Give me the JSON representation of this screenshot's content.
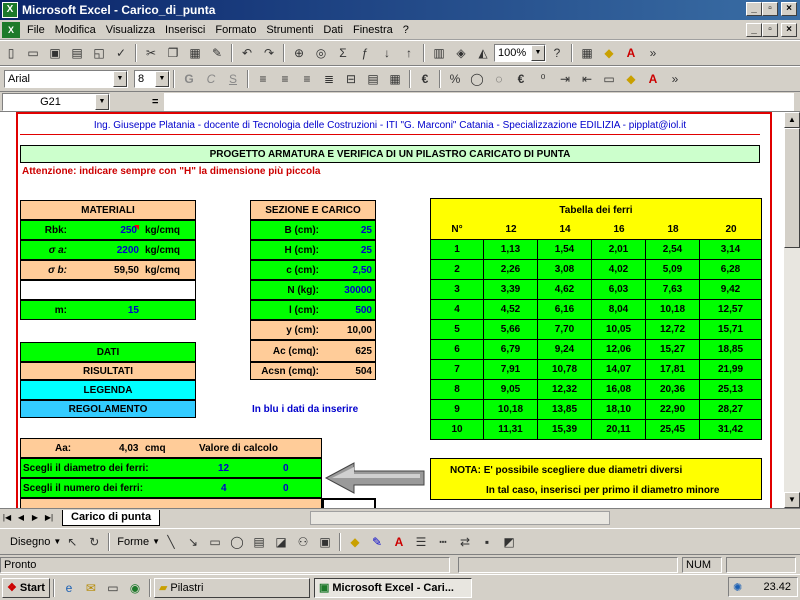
{
  "window": {
    "title": "Microsoft Excel - Carico_di_punta",
    "min": "_",
    "max": "▫",
    "close": "×"
  },
  "menu": [
    "File",
    "Modifica",
    "Visualizza",
    "Inserisci",
    "Formato",
    "Strumenti",
    "Dati",
    "Finestra",
    "?"
  ],
  "toolbar": {
    "zoom": "100%",
    "font": "Arial",
    "size": "8"
  },
  "formula": {
    "namebox": "G21",
    "eq": "="
  },
  "sheet": {
    "header": "Ing. Giuseppe Platania - docente di Tecnologia delle Costruzioni - ITI \"G. Marconi\" Catania - Specializzazione EDILIZIA - pipplat@iol.it",
    "title": "PROGETTO ARMATURA E VERIFICA DI UN PILASTRO CARICATO DI PUNTA",
    "warning": "Attenzione: indicare sempre con \"H\" la dimensione più piccola",
    "materiali": {
      "title": "MATERIALI",
      "rows": [
        {
          "label": "Rbk:",
          "value": "250",
          "unit": "kg/cmq"
        },
        {
          "label": "σ a:",
          "value": "2200",
          "unit": "kg/cmq"
        },
        {
          "label": "σ b:",
          "value": "59,50",
          "unit": "kg/cmq"
        }
      ],
      "m_label": "m:",
      "m_value": "15"
    },
    "sezione": {
      "title": "SEZIONE E CARICO",
      "inputs": [
        {
          "label": "B (cm):",
          "value": "25"
        },
        {
          "label": "H (cm):",
          "value": "25"
        },
        {
          "label": "c (cm):",
          "value": "2,50"
        },
        {
          "label": "N (kg):",
          "value": "30000"
        },
        {
          "label": "l (cm):",
          "value": "500"
        }
      ],
      "results": [
        {
          "label": "y (cm):",
          "value": "10,00"
        },
        {
          "label": "Ac (cmq):",
          "value": "625"
        },
        {
          "label": "Acsn (cmq):",
          "value": "504"
        }
      ]
    },
    "legend": [
      "DATI",
      "RISULTATI",
      "LEGENDA",
      "REGOLAMENTO"
    ],
    "blue_note": "In blu i dati da inserire",
    "tabella": {
      "title": "Tabella dei ferri",
      "headers": [
        "N°",
        "12",
        "14",
        "16",
        "18",
        "20"
      ],
      "rows": [
        [
          "1",
          "1,13",
          "1,54",
          "2,01",
          "2,54",
          "3,14"
        ],
        [
          "2",
          "2,26",
          "3,08",
          "4,02",
          "5,09",
          "6,28"
        ],
        [
          "3",
          "3,39",
          "4,62",
          "6,03",
          "7,63",
          "9,42"
        ],
        [
          "4",
          "4,52",
          "6,16",
          "8,04",
          "10,18",
          "12,57"
        ],
        [
          "5",
          "5,66",
          "7,70",
          "10,05",
          "12,72",
          "15,71"
        ],
        [
          "6",
          "6,79",
          "9,24",
          "12,06",
          "15,27",
          "18,85"
        ],
        [
          "7",
          "7,91",
          "10,78",
          "14,07",
          "17,81",
          "21,99"
        ],
        [
          "8",
          "9,05",
          "12,32",
          "16,08",
          "20,36",
          "25,13"
        ],
        [
          "9",
          "10,18",
          "13,85",
          "18,10",
          "22,90",
          "28,27"
        ],
        [
          "10",
          "11,31",
          "15,39",
          "20,11",
          "25,45",
          "31,42"
        ]
      ]
    },
    "calc": {
      "aa_label": "Aa:",
      "aa_value": "4,03",
      "aa_unit": "cmq",
      "valore": "Valore di calcolo",
      "diam_label": "Scegli il diametro dei ferri:",
      "diam1": "12",
      "diam2": "0",
      "num_label": "Scegli il numero dei ferri:",
      "num1": "4",
      "num2": "0"
    },
    "nota": {
      "line1": "NOTA:  E' possibile scegliere due diametri diversi",
      "line2": "In tal caso, inserisci per primo il diametro minore"
    }
  },
  "tabs": {
    "active": "Carico di punta"
  },
  "drawbar": {
    "disegno": "Disegno",
    "forme": "Forme"
  },
  "status": {
    "left": "Pronto",
    "num": "NUM"
  },
  "taskbar": {
    "start": "Start",
    "task1": "Pilastri",
    "task2": "Microsoft Excel - Cari...",
    "clock": "23.42"
  }
}
